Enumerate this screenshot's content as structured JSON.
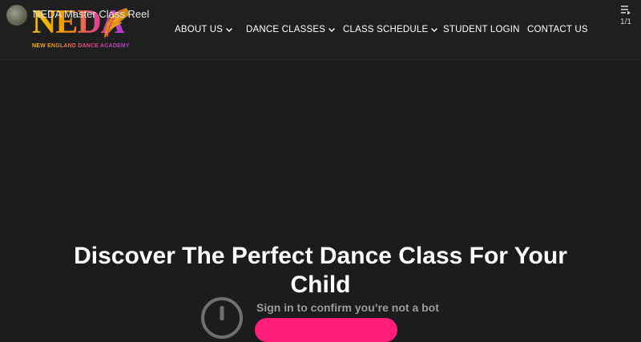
{
  "header": {
    "logo_text": "NEDA",
    "logo_subtitle": "NEW ENGLAND DANCE ACADEMY",
    "nav": [
      {
        "label": "ABOUT US",
        "has_dropdown": true
      },
      {
        "label": "DANCE CLASSES",
        "has_dropdown": true
      },
      {
        "label": "CLASS SCHEDULE",
        "has_dropdown": true
      },
      {
        "label": "STUDENT LOGIN",
        "has_dropdown": false
      },
      {
        "label": "CONTACT US",
        "has_dropdown": false
      }
    ]
  },
  "video": {
    "title": "NEDA Master Class Reel",
    "playlist_count": "1/1"
  },
  "hero": {
    "title": "Discover The Perfect Dance Class For Your Child",
    "bot_message": "Sign in to confirm you’re not a bot"
  },
  "colors": {
    "background": "#1c1c1c",
    "accent": "#ff1e7a",
    "logo_gold": "#f5c400",
    "logo_pink": "#e1458a",
    "logo_purple": "#b23fd0"
  },
  "icons": {
    "playlist": "playlist-icon",
    "chevron": "chevron-down-icon",
    "alert": "alert-circle-icon"
  }
}
